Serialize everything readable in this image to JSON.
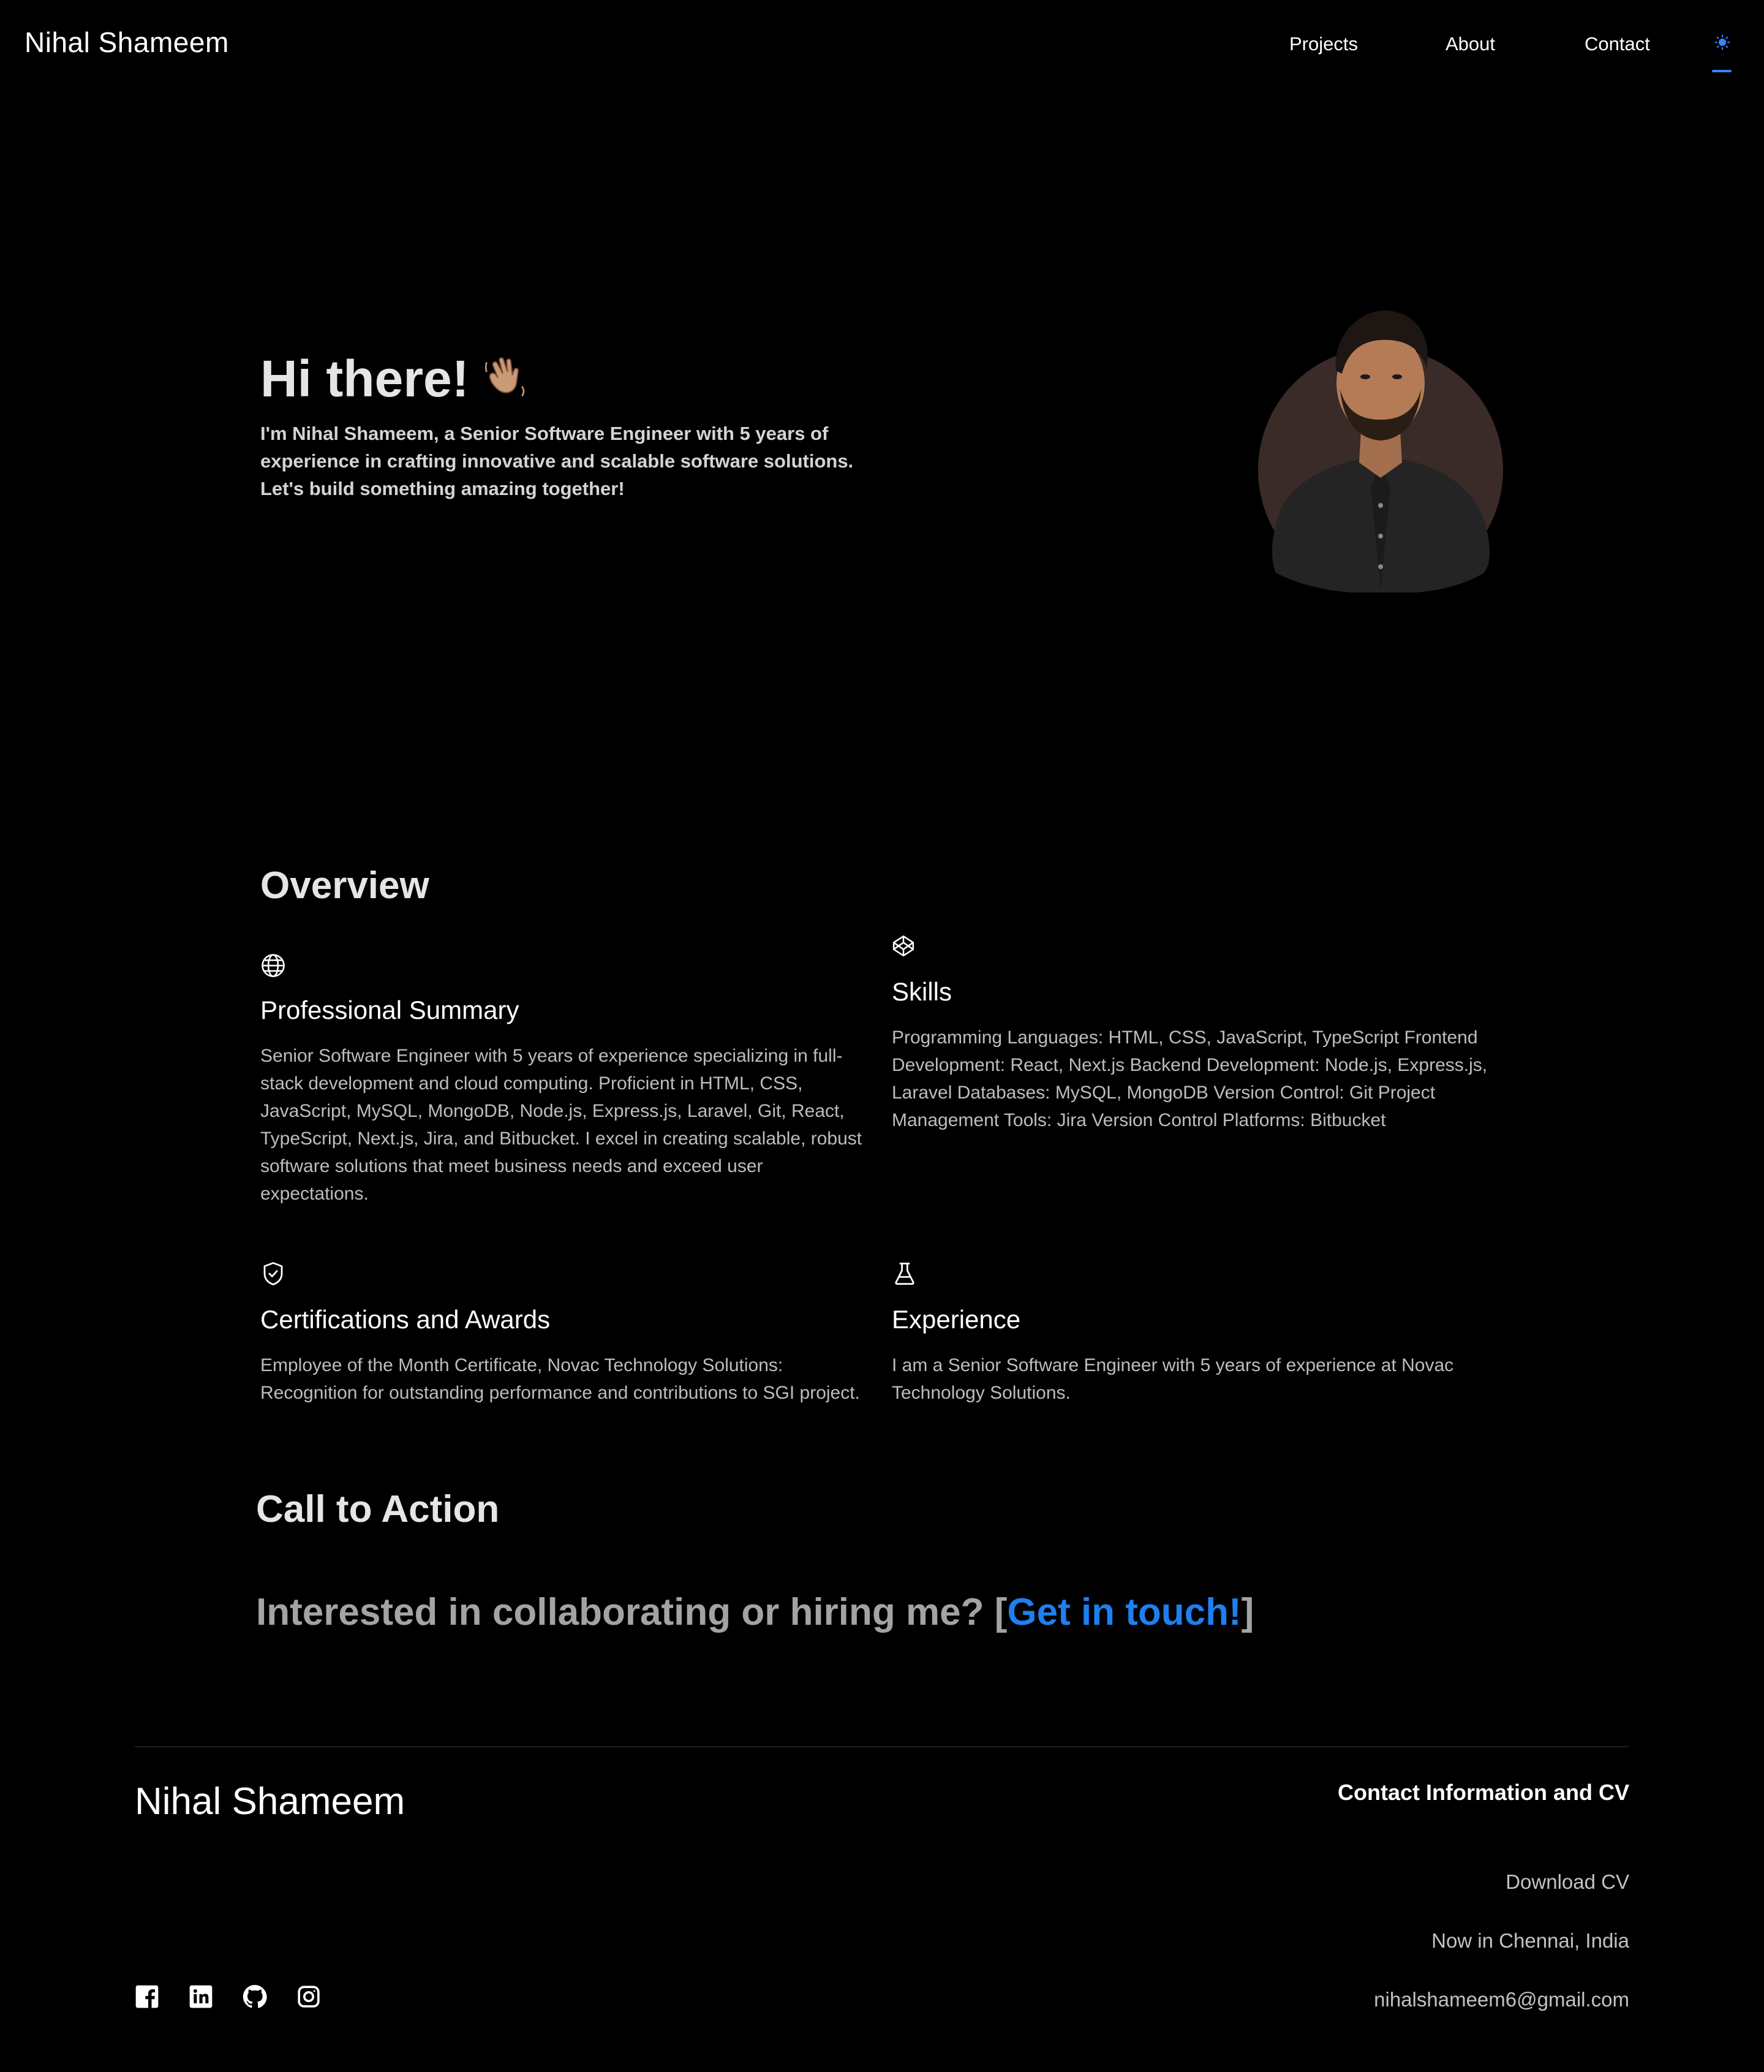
{
  "header": {
    "brand": "Nihal Shameem",
    "nav": {
      "projects": "Projects",
      "about": "About",
      "contact": "Contact"
    },
    "theme_icon": "sun-icon",
    "accent_color": "#3b82f6"
  },
  "hero": {
    "greeting": "Hi there!",
    "wave_icon": "waving-hand-icon",
    "intro": "I'm Nihal Shameem, a Senior Software Engineer with 5 years of experience in crafting innovative and scalable software solutions. Let's build something amazing together!",
    "avatar_icon": "profile-photo"
  },
  "overview": {
    "title": "Overview",
    "cards": [
      {
        "icon": "globe-icon",
        "title": "Professional Summary",
        "text": "Senior Software Engineer with 5 years of experience specializing in full-stack development and cloud computing. Proficient in HTML, CSS, JavaScript, MySQL, MongoDB, Node.js, Express.js, Laravel, Git, React, TypeScript, Next.js, Jira, and Bitbucket. I excel in creating scalable, robust software solutions that meet business needs and exceed user expectations."
      },
      {
        "icon": "codepen-icon",
        "title": "Skills",
        "text": "Programming Languages: HTML, CSS, JavaScript, TypeScript Frontend Development: React, Next.js Backend Development: Node.js, Express.js, Laravel Databases: MySQL, MongoDB Version Control: Git Project Management Tools: Jira Version Control Platforms: Bitbucket"
      },
      {
        "icon": "shield-check-icon",
        "title": "Certifications and Awards",
        "text": "Employee of the Month Certificate, Novac Technology Solutions: Recognition for outstanding performance and contributions to SGI project."
      },
      {
        "icon": "flask-icon",
        "title": "Experience",
        "text": "I am a Senior Software Engineer with 5 years of experience at Novac Technology Solutions."
      }
    ]
  },
  "cta": {
    "title": "Call to Action",
    "prefix": "Interested in collaborating or hiring me? [",
    "link_label": "Get in touch!",
    "suffix": "]",
    "link_color": "#1d7ff0"
  },
  "footer": {
    "brand": "Nihal Shameem",
    "heading": "Contact Information and CV",
    "download_cv": "Download CV",
    "location": "Now in Chennai, India",
    "email": "nihalshameem6@gmail.com",
    "socials": [
      "facebook-icon",
      "linkedin-icon",
      "github-icon",
      "instagram-icon"
    ]
  }
}
